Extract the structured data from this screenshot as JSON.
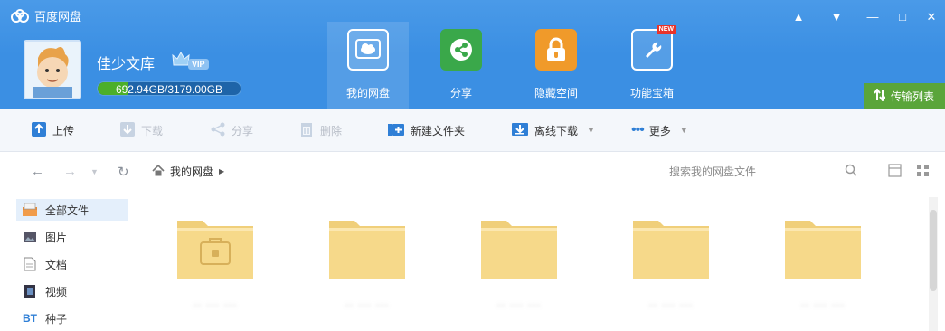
{
  "app": {
    "title": "百度网盘"
  },
  "user": {
    "name": "佳少文库",
    "vip_label": "VIP",
    "quota_text": "692.94GB/3179.00GB",
    "quota_used_fraction": 0.218
  },
  "nav_tabs": [
    {
      "label": "我的网盘",
      "icon": "cloud-icon",
      "active": true
    },
    {
      "label": "分享",
      "icon": "share-icon"
    },
    {
      "label": "隐藏空间",
      "icon": "lock-icon"
    },
    {
      "label": "功能宝箱",
      "icon": "toolbox-icon",
      "badge": "NEW"
    }
  ],
  "window_controls": [
    "notification-icon",
    "menu-icon",
    "minimize-icon",
    "maximize-icon",
    "close-icon"
  ],
  "transfer_label": "传输列表",
  "toolbar": {
    "upload": "上传",
    "download": "下载",
    "share": "分享",
    "delete": "删除",
    "new_folder": "新建文件夹",
    "offline_download": "离线下载",
    "more": "更多"
  },
  "address": {
    "breadcrumb_root": "我的网盘",
    "search_placeholder": "搜索我的网盘文件"
  },
  "sidebar": {
    "items": [
      {
        "label": "全部文件",
        "icon": "all-files-icon",
        "active": true
      },
      {
        "label": "图片",
        "icon": "image-icon"
      },
      {
        "label": "文档",
        "icon": "document-icon"
      },
      {
        "label": "视频",
        "icon": "video-icon"
      },
      {
        "label": "种子",
        "icon": "bt-icon"
      }
    ]
  },
  "folders": [
    {
      "name": "·· ··· ···",
      "type": "private"
    },
    {
      "name": "·· ··· ···",
      "type": "folder"
    },
    {
      "name": "·· ··· ···",
      "type": "folder"
    },
    {
      "name": "·· ··· ···",
      "type": "folder"
    },
    {
      "name": "·· ··· ···",
      "type": "folder"
    }
  ],
  "colors": {
    "header_blue": "#3b8fe3",
    "toolbar_bg": "#f4f7fb",
    "quota_green": "#4caf2a",
    "transfer_green": "#5aa53a",
    "folder_yellow": "#f6d98a",
    "tab_share_green": "#3aa84a",
    "tab_lock_orange": "#f09a2a"
  }
}
